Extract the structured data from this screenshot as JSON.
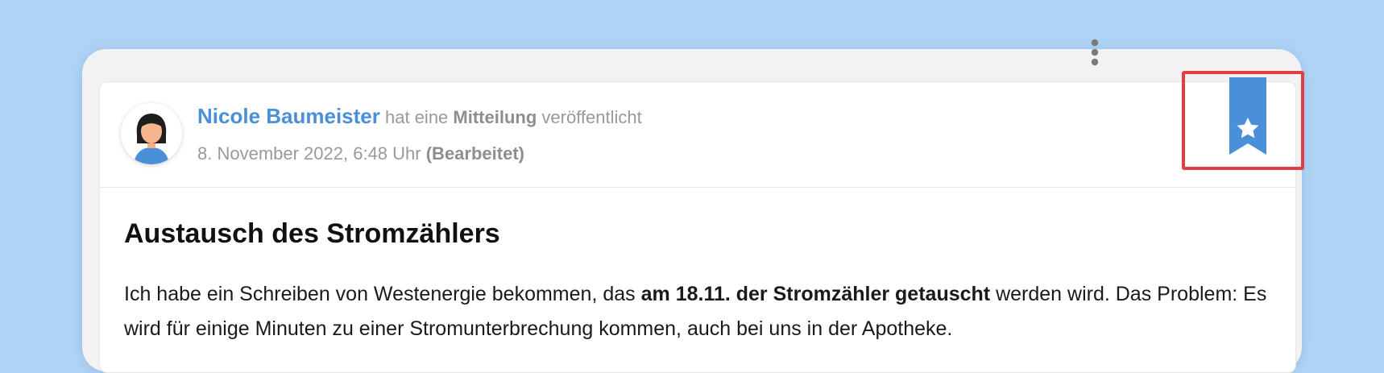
{
  "post": {
    "author": {
      "name": "Nicole Baumeister",
      "avatar_icon": "woman-avatar-icon"
    },
    "action_prefix": "hat eine",
    "action_type": "Mitteilung",
    "action_suffix": "veröffentlicht",
    "timestamp": "8. November 2022, 6:48 Uhr",
    "edited_label": "(Bearbeitet)",
    "title": "Austausch des Stromzählers",
    "body": {
      "line1_before": "Ich habe ein Schreiben von Westenergie bekommen, das",
      "line1_bold": "am 18.11. der Stromzähler getauscht",
      "line1_after": "werden wird. Das",
      "line2": "Problem: Es wird für einige Minuten zu einer Stromunterbrechung kommen, auch bei uns in der Apotheke."
    }
  },
  "actions": {
    "more_icon": "vertical-dots-icon",
    "bookmark_icon": "bookmark-star-icon",
    "bookmark_color": "#4a90d9"
  },
  "colors": {
    "background": "#afd3f5",
    "accent": "#4a90d9",
    "highlight": "#e23c44"
  }
}
